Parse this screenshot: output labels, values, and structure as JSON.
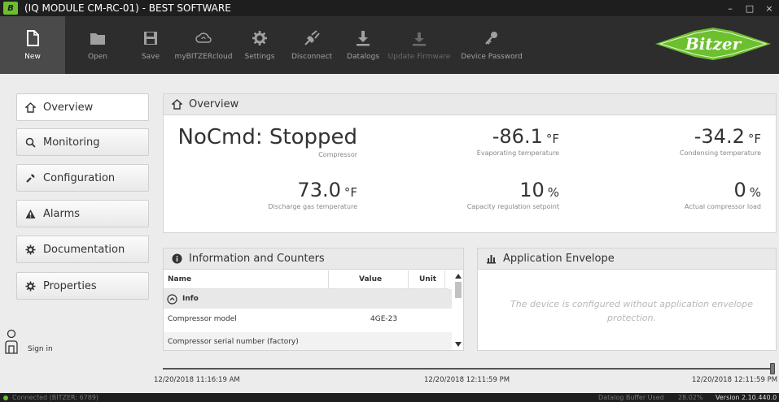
{
  "window": {
    "logo_text": "B",
    "title": "(IQ MODULE CM-RC-01) - BEST SOFTWARE",
    "minimize": "–",
    "maximize": "□",
    "close": "×"
  },
  "toolbar": {
    "items": [
      {
        "label": "New",
        "icon": "new-document-icon",
        "state": "active"
      },
      {
        "label": "Open",
        "icon": "folder-icon",
        "state": "normal"
      },
      {
        "label": "Save",
        "icon": "floppy-disk-icon",
        "state": "normal"
      },
      {
        "label": "myBITZERcloud",
        "icon": "cloud-icon",
        "state": "normal"
      },
      {
        "label": "Settings",
        "icon": "gear-icon",
        "state": "normal"
      },
      {
        "label": "Disconnect",
        "icon": "plug-icon",
        "state": "normal"
      },
      {
        "label": "Datalogs",
        "icon": "download-icon",
        "state": "normal"
      },
      {
        "label": "Update Firmware",
        "icon": "upload-icon",
        "state": "disabled"
      },
      {
        "label": "Device Password",
        "icon": "key-icon",
        "state": "normal"
      }
    ],
    "brand_text": "Bitzer",
    "brand_color": "#6cbf2e"
  },
  "sidebar": {
    "items": [
      {
        "label": "Overview",
        "icon": "home-icon"
      },
      {
        "label": "Monitoring",
        "icon": "magnifier-icon"
      },
      {
        "label": "Configuration",
        "icon": "wrench-icon"
      },
      {
        "label": "Alarms",
        "icon": "warning-icon"
      },
      {
        "label": "Documentation",
        "icon": "gear-icon"
      },
      {
        "label": "Properties",
        "icon": "gear-icon"
      }
    ],
    "sign_in": "Sign in"
  },
  "overview": {
    "title": "Overview",
    "status": {
      "value": "NoCmd: Stopped",
      "caption": "Compressor"
    },
    "evaporating": {
      "value": "-86.1",
      "unit": "°F",
      "caption": "Evaporating temperature"
    },
    "condensing": {
      "value": "-34.2",
      "unit": "°F",
      "caption": "Condensing temperature"
    },
    "discharge": {
      "value": "73.0",
      "unit": "°F",
      "caption": "Discharge gas temperature"
    },
    "capacity": {
      "value": "10",
      "unit": "%",
      "caption": "Capacity regulation setpoint"
    },
    "load": {
      "value": "0",
      "unit": "%",
      "caption": "Actual compressor load"
    }
  },
  "info": {
    "title": "Information and Counters",
    "columns": {
      "name": "Name",
      "value": "Value",
      "unit": "Unit"
    },
    "group": "Info",
    "rows": [
      {
        "name": "Compressor model",
        "value": "4GE-23",
        "unit": ""
      },
      {
        "name": "Compressor serial number (factory)",
        "value": "",
        "unit": ""
      }
    ]
  },
  "envelope": {
    "title": "Application Envelope",
    "message": "The device is configured without application envelope protection."
  },
  "timeline": {
    "start": "12/20/2018 11:16:19 AM",
    "middle": "12/20/2018 12:11:59 PM",
    "end": "12/20/2018 12:11:59 PM",
    "position": 1.0
  },
  "status": {
    "connection": "Connected (BITZER: 6789)",
    "buffer_label": "Datalog Buffer Used",
    "buffer_value": "28.02%",
    "version": "Version 2.10.440.0"
  }
}
